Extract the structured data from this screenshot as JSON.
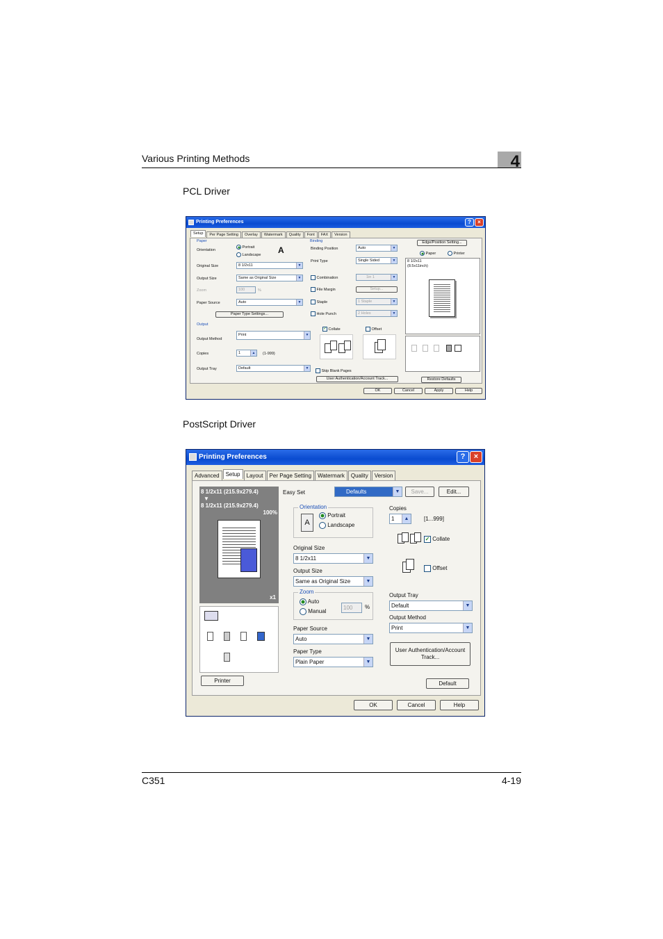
{
  "header": {
    "section_title": "Various Printing Methods",
    "chapter_number": "4"
  },
  "sections": {
    "pcl_heading": "PCL Driver",
    "ps_heading": "PostScript Driver"
  },
  "footer": {
    "model": "C351",
    "page": "4-19"
  },
  "pcl": {
    "title": "Printing Preferences",
    "help_glyph": "?",
    "close_glyph": "×",
    "tabs": [
      "Setup",
      "Per Page Setting",
      "Overlay",
      "Watermark",
      "Quality",
      "Font",
      "FAX",
      "Version"
    ],
    "active_tab": "Setup",
    "paper_group": "Paper",
    "orientation_label": "Orientation",
    "portrait": "Portrait",
    "landscape": "Landscape",
    "original_size_label": "Original Size",
    "original_size_value": "8 1/2x11",
    "output_size_label": "Output Size",
    "output_size_value": "Same as Original Size",
    "zoom_label": "Zoom",
    "zoom_value": "100",
    "zoom_unit": "%",
    "paper_source_label": "Paper Source",
    "paper_source_value": "Auto",
    "paper_type_button": "Paper Type Settings...",
    "output_group": "Output",
    "output_method_label": "Output Method",
    "output_method_value": "Print",
    "copies_label": "Copies",
    "copies_value": "1",
    "copies_range": "(1-999)",
    "output_tray_label": "Output Tray",
    "output_tray_value": "Default",
    "binding_group": "Binding",
    "binding_position_label": "Binding Position",
    "binding_position_value": "Auto",
    "print_type_label": "Print Type",
    "print_type_value": "Single Sided",
    "combination_label": "Combination",
    "combination_value": "1in 1",
    "file_margin_label": "File Margin",
    "file_margin_button": "Setup...",
    "staple_label": "Staple",
    "staple_value": "1 Staple",
    "hole_punch_label": "Hole Punch",
    "hole_punch_value": "2 Holes",
    "collate_label": "Collate",
    "offset_label": "Offset",
    "skip_blank_label": "Skip Blank Pages",
    "user_auth_button": "User Authentication/Account Track...",
    "edge_button": "Edge/Position Setting...",
    "view_paper": "Paper",
    "view_printer": "Printer",
    "preview_line1": "8 1/2x11",
    "preview_line2": "(8.5x11inch)",
    "restore_button": "Restore Defaults",
    "ok_button": "OK",
    "cancel_button": "Cancel",
    "apply_button": "Apply",
    "help_button": "Help"
  },
  "ps": {
    "title": "Printing Preferences",
    "help_glyph": "?",
    "close_glyph": "×",
    "tabs": [
      "Advanced",
      "Setup",
      "Layout",
      "Per Page Setting",
      "Watermark",
      "Quality",
      "Version"
    ],
    "active_tab": "Setup",
    "preview_line1": "8 1/2x11 (215.9x279.4)",
    "preview_arrow": "▼",
    "preview_line2": "8 1/2x11 (215.9x279.4)",
    "preview_zoom": "100%",
    "preview_copies": "x1",
    "easy_set_label": "Easy Set",
    "easy_set_value": "Defaults",
    "save_button": "Save...",
    "edit_button": "Edit...",
    "orientation_group": "Orientation",
    "portrait": "Portrait",
    "landscape": "Landscape",
    "original_size_label": "Original Size",
    "original_size_value": "8 1/2x11",
    "output_size_label": "Output Size",
    "output_size_value": "Same as Original Size",
    "zoom_group": "Zoom",
    "zoom_auto": "Auto",
    "zoom_manual": "Manual",
    "zoom_value": "100",
    "zoom_unit": "%",
    "paper_source_label": "Paper Source",
    "paper_source_value": "Auto",
    "paper_type_label": "Paper Type",
    "paper_type_value": "Plain Paper",
    "copies_label": "Copies",
    "copies_value": "1",
    "copies_range": "[1...999]",
    "collate_label": "Collate",
    "offset_label": "Offset",
    "output_tray_label": "Output Tray",
    "output_tray_value": "Default",
    "output_method_label": "Output Method",
    "output_method_value": "Print",
    "user_auth_line1": "User Authentication/Account",
    "user_auth_line2": "Track...",
    "printer_button": "Printer",
    "default_button": "Default",
    "ok_button": "OK",
    "cancel_button": "Cancel",
    "help_button": "Help"
  }
}
